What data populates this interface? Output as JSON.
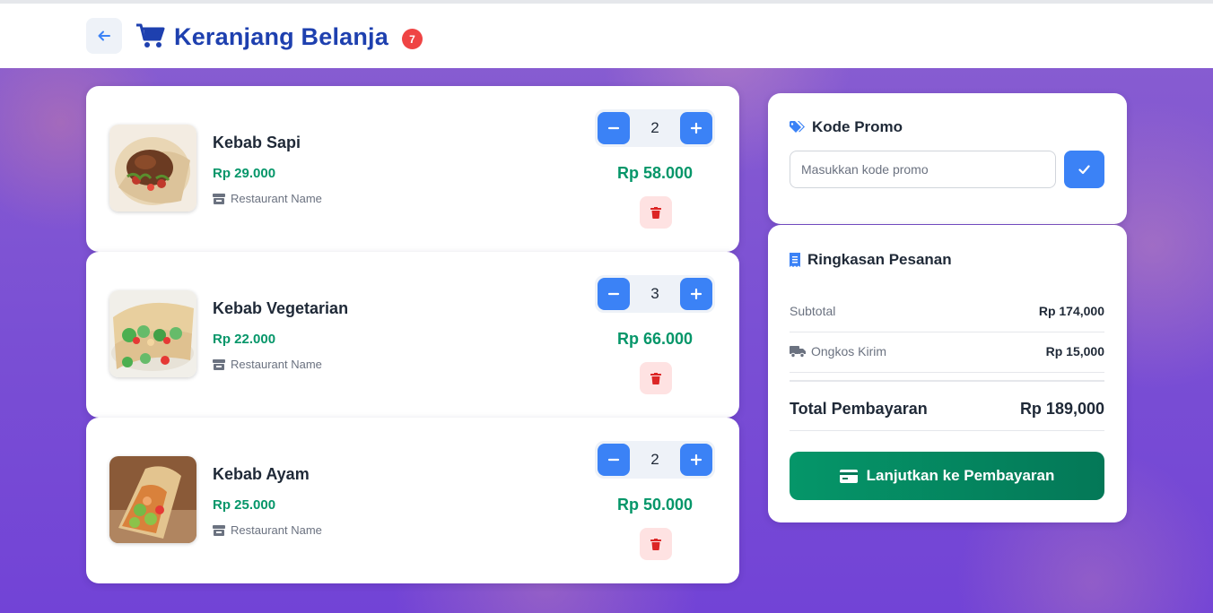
{
  "header": {
    "title": "Keranjang Belanja",
    "cart_count": "7",
    "back_icon": "arrow-left-icon",
    "cart_icon": "shopping-cart-icon"
  },
  "cart": {
    "items": [
      {
        "name": "Kebab Sapi",
        "price": "Rp 29.000",
        "restaurant": "Restaurant Name",
        "quantity": "2",
        "line_total": "Rp 58.000"
      },
      {
        "name": "Kebab Vegetarian",
        "price": "Rp 22.000",
        "restaurant": "Restaurant Name",
        "quantity": "3",
        "line_total": "Rp 66.000"
      },
      {
        "name": "Kebab Ayam",
        "price": "Rp 25.000",
        "restaurant": "Restaurant Name",
        "quantity": "2",
        "line_total": "Rp 50.000"
      }
    ]
  },
  "promo": {
    "title": "Kode Promo",
    "placeholder": "Masukkan kode promo",
    "value": ""
  },
  "summary": {
    "title": "Ringkasan Pesanan",
    "subtotal_label": "Subtotal",
    "subtotal_value": "Rp 174,000",
    "shipping_label": "Ongkos Kirim",
    "shipping_value": "Rp 15,000",
    "total_label": "Total Pembayaran",
    "total_value": "Rp 189,000",
    "checkout_label": "Lanjutkan ke Pembayaran"
  },
  "colors": {
    "primary_blue": "#3b82f6",
    "title_blue": "#1e40af",
    "price_green": "#059669",
    "badge_red": "#ef4444",
    "delete_bg": "#fee2e2",
    "background_purple": "#7a4fd4"
  }
}
